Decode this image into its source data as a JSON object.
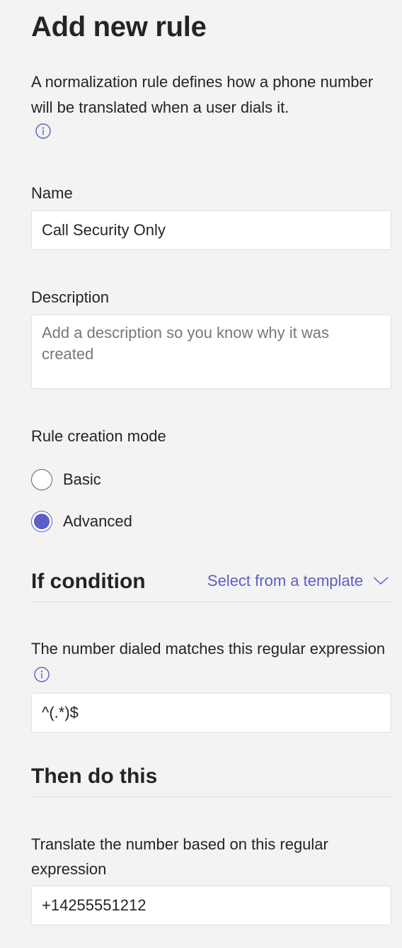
{
  "dialog": {
    "title": "Add new rule",
    "description": "A normalization rule defines how a phone number will be translated when a user dials it."
  },
  "name_field": {
    "label": "Name",
    "value": "Call Security Only"
  },
  "description_field": {
    "label": "Description",
    "placeholder": "Add a description so you know why it was created"
  },
  "mode": {
    "label": "Rule creation mode",
    "options": [
      {
        "label": "Basic",
        "checked": false
      },
      {
        "label": "Advanced",
        "checked": true
      }
    ]
  },
  "if_condition": {
    "title": "If condition",
    "template_link": "Select from a template",
    "pattern_label": "The number dialed matches this regular expression",
    "pattern_value": "^(.*)$"
  },
  "then_do": {
    "title": "Then do this",
    "translation_label": "Translate the number based on this regular expression",
    "translation_value": "+14255551212"
  },
  "colors": {
    "accent": "#5b5fc7",
    "background": "#f3f3f3",
    "text": "#252423"
  },
  "icons": [
    "info-icon",
    "chevron-down-icon"
  ]
}
